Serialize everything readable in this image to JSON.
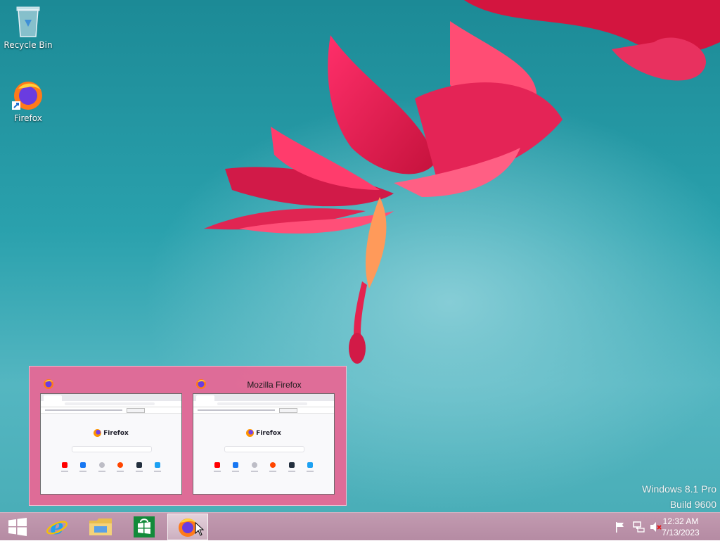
{
  "desktop": {
    "icons": [
      {
        "label": "Recycle Bin",
        "icon": "recycle-bin-icon"
      },
      {
        "label": "Firefox",
        "icon": "firefox-icon"
      }
    ],
    "watermark": {
      "line1": "Windows 8.1 Pro",
      "line2": "Build 9600"
    }
  },
  "flyout": {
    "windows": [
      {
        "title": "",
        "icon": "firefox-icon"
      },
      {
        "title": "Mozilla Firefox",
        "icon": "firefox-icon"
      }
    ],
    "page_logo_text": "Firefox",
    "accent": "#e46996"
  },
  "taskbar": {
    "items": [
      {
        "name": "start",
        "icon": "windows-logo-icon"
      },
      {
        "name": "internet-explorer",
        "icon": "ie-icon"
      },
      {
        "name": "file-explorer",
        "icon": "folder-icon"
      },
      {
        "name": "store",
        "icon": "store-icon"
      },
      {
        "name": "firefox",
        "icon": "firefox-icon",
        "active": true
      }
    ],
    "tray": {
      "icons": [
        "flag-icon",
        "network-icon",
        "volume-muted-icon"
      ],
      "time": "12:32 AM",
      "date": "7/13/2023"
    },
    "color": "#b58ba3"
  }
}
